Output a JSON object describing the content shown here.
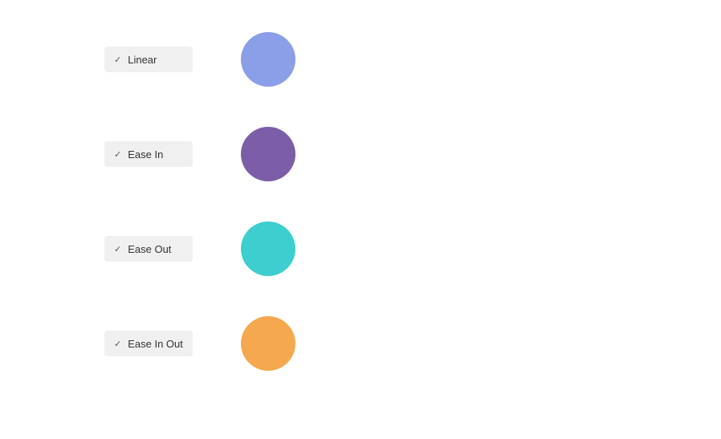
{
  "easings": [
    {
      "id": "linear",
      "label": "Linear",
      "checkmark": "✓",
      "circle_color": "#8b9ee8",
      "circle_class": "circle-linear"
    },
    {
      "id": "ease-in",
      "label": "Ease In",
      "checkmark": "✓",
      "circle_color": "#7b5ea7",
      "circle_class": "circle-ease-in"
    },
    {
      "id": "ease-out",
      "label": "Ease Out",
      "checkmark": "✓",
      "circle_color": "#3dcfcf",
      "circle_class": "circle-ease-out"
    },
    {
      "id": "ease-in-out",
      "label": "Ease In Out",
      "checkmark": "✓",
      "circle_color": "#f5a84e",
      "circle_class": "circle-ease-in-out"
    }
  ]
}
